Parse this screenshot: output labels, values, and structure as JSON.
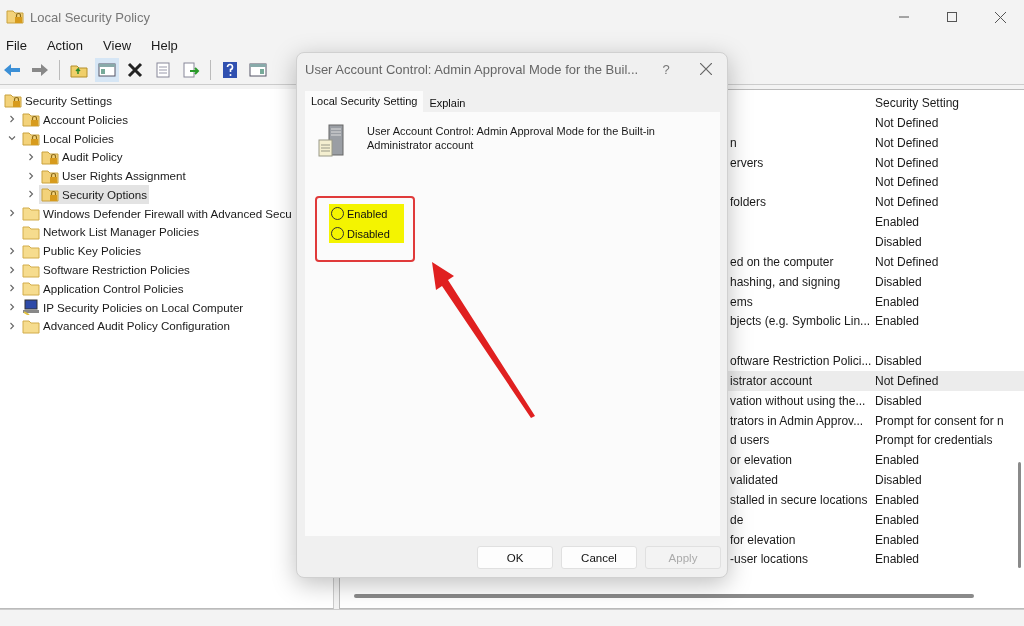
{
  "window": {
    "title": "Local Security Policy"
  },
  "menu": [
    "File",
    "Action",
    "View",
    "Help"
  ],
  "toolbar": [
    {
      "pressed": false
    },
    {
      "pressed": false
    },
    {
      "pressed": false
    },
    {
      "pressed": true
    },
    {
      "pressed": false
    },
    {
      "pressed": false
    },
    {
      "pressed": false
    },
    {
      "pressed": false
    },
    {
      "pressed": false
    }
  ],
  "tree": [
    {
      "label": "Security Settings",
      "kind": "lock-folder",
      "selected": false,
      "children": [
        {
          "label": "Account Policies",
          "kind": "lock-folder",
          "expandable": true,
          "expanded": false,
          "selected": false
        },
        {
          "label": "Local Policies",
          "kind": "lock-folder",
          "expandable": true,
          "expanded": true,
          "selected": false,
          "children": [
            {
              "label": "Audit Policy",
              "kind": "lock-folder",
              "expandable": true,
              "expanded": false,
              "selected": false
            },
            {
              "label": "User Rights Assignment",
              "kind": "lock-folder",
              "expandable": true,
              "expanded": false,
              "selected": false
            },
            {
              "label": "Security Options",
              "kind": "lock-folder",
              "expandable": true,
              "expanded": false,
              "selected": true
            }
          ]
        },
        {
          "label": "Windows Defender Firewall with Advanced Secu",
          "kind": "folder",
          "expandable": true,
          "expanded": false,
          "selected": false
        },
        {
          "label": "Network List Manager Policies",
          "kind": "folder",
          "expandable": false,
          "selected": false
        },
        {
          "label": "Public Key Policies",
          "kind": "folder",
          "expandable": true,
          "expanded": false,
          "selected": false
        },
        {
          "label": "Software Restriction Policies",
          "kind": "folder",
          "expandable": true,
          "expanded": false,
          "selected": false
        },
        {
          "label": "Application Control Policies",
          "kind": "folder",
          "expandable": true,
          "expanded": false,
          "selected": false
        },
        {
          "label": "IP Security Policies on Local Computer",
          "kind": "computer",
          "expandable": true,
          "expanded": false,
          "selected": false
        },
        {
          "label": "Advanced Audit Policy Configuration",
          "kind": "folder",
          "expandable": true,
          "expanded": false,
          "selected": false
        }
      ]
    }
  ],
  "list": {
    "header": "Security Setting",
    "rows": [
      {
        "setting": "Not Defined",
        "selected": false
      },
      {
        "policy": "n",
        "setting": "Not Defined",
        "selected": false
      },
      {
        "policy": "ervers",
        "setting": "Not Defined",
        "selected": false
      },
      {
        "setting": "Not Defined",
        "selected": false
      },
      {
        "policy": "folders",
        "setting": "Not Defined",
        "selected": false
      },
      {
        "setting": "Enabled",
        "selected": false
      },
      {
        "setting": "Disabled",
        "selected": false
      },
      {
        "policy": "ed on the computer",
        "setting": "Not Defined",
        "selected": false
      },
      {
        "policy": "hashing, and signing",
        "setting": "Disabled",
        "selected": false
      },
      {
        "policy": "ems",
        "setting": "Enabled",
        "selected": false
      },
      {
        "policy": "bjects (e.g. Symbolic Lin...",
        "setting": "Enabled",
        "selected": false
      },
      {
        "selected": false
      },
      {
        "policy": "oftware Restriction Polici...",
        "setting": "Disabled",
        "selected": false
      },
      {
        "policy": "istrator account",
        "setting": "Not Defined",
        "selected": true
      },
      {
        "policy": "vation without using the...",
        "setting": "Disabled",
        "selected": false
      },
      {
        "policy": "trators in Admin Approv...",
        "setting": "Prompt for consent for n",
        "selected": false
      },
      {
        "policy": "d users",
        "setting": "Prompt for credentials",
        "selected": false
      },
      {
        "policy": "or elevation",
        "setting": "Enabled",
        "selected": false
      },
      {
        "policy": "validated",
        "setting": "Disabled",
        "selected": false
      },
      {
        "policy": "stalled in secure locations",
        "setting": "Enabled",
        "selected": false
      },
      {
        "policy": "de",
        "setting": "Enabled",
        "selected": false
      },
      {
        "policy": "for elevation",
        "setting": "Enabled",
        "selected": false
      },
      {
        "policy": "-user locations",
        "setting": "Enabled",
        "selected": false
      }
    ]
  },
  "dialog": {
    "title": "User Account Control: Admin Approval Mode for the Buil...",
    "help": "?",
    "tabs": [
      {
        "label": "Local Security Setting",
        "selected": true
      },
      {
        "label": "Explain",
        "selected": false
      }
    ],
    "description": "User Account Control: Admin Approval Mode for the Built-in Administrator account",
    "options": [
      {
        "label": "Enabled",
        "checked": false
      },
      {
        "label": "Disabled",
        "checked": false
      }
    ],
    "buttons": [
      {
        "label": "OK",
        "disabled": false
      },
      {
        "label": "Cancel",
        "disabled": false
      },
      {
        "label": "Apply",
        "disabled": true
      }
    ]
  }
}
